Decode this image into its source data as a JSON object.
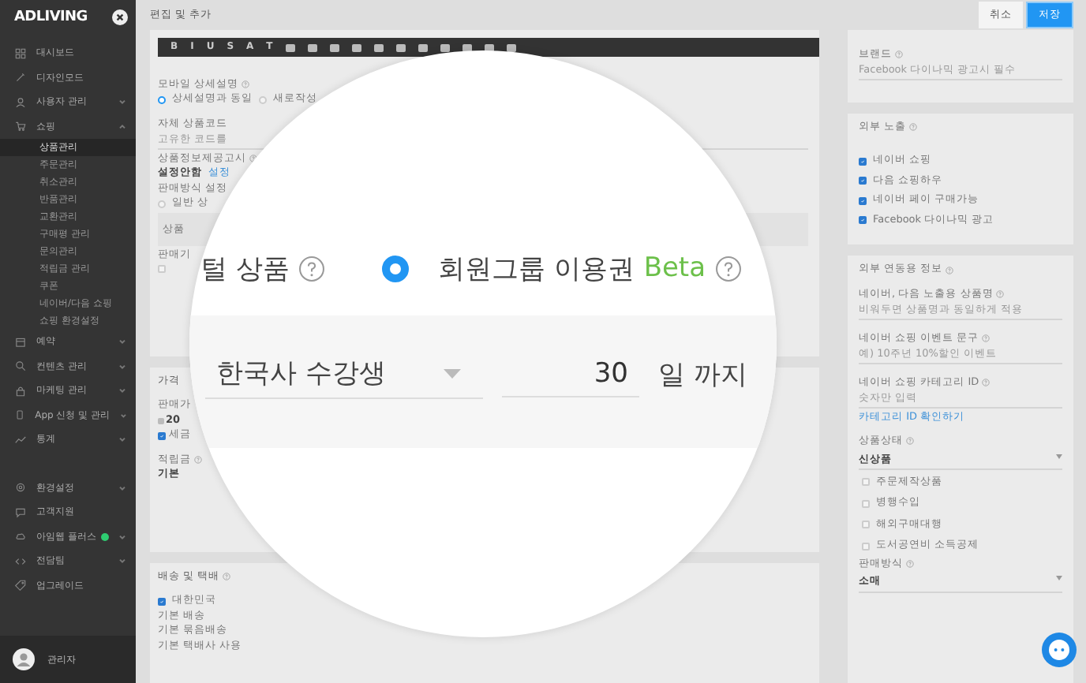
{
  "sidebar": {
    "brand": "ADLIVING",
    "items": [
      {
        "label": "대시보드",
        "kind": "link"
      },
      {
        "label": "디자인모드",
        "kind": "link"
      },
      {
        "label": "사용자 관리",
        "kind": "menu",
        "expanded": false
      },
      {
        "label": "쇼핑",
        "kind": "menu",
        "expanded": true,
        "children": [
          {
            "label": "상품관리",
            "selected": true
          },
          {
            "label": "주문관리",
            "selected": false
          },
          {
            "label": "취소관리",
            "selected": false
          },
          {
            "label": "반품관리",
            "selected": false
          },
          {
            "label": "교환관리",
            "selected": false
          },
          {
            "label": "구매평 관리",
            "selected": false
          },
          {
            "label": "문의관리",
            "selected": false
          },
          {
            "label": "적립금 관리",
            "selected": false
          },
          {
            "label": "쿠폰",
            "selected": false
          },
          {
            "label": "네이버/다음 쇼핑",
            "selected": false
          },
          {
            "label": "쇼핑 환경설정",
            "selected": false
          }
        ]
      },
      {
        "label": "예약",
        "kind": "menu",
        "expanded": false
      },
      {
        "label": "컨텐츠 관리",
        "kind": "menu",
        "expanded": false
      },
      {
        "label": "마케팅 관리",
        "kind": "menu",
        "expanded": false
      },
      {
        "label": "App 신청 및 관리",
        "kind": "menu",
        "expanded": false
      },
      {
        "label": "통계",
        "kind": "menu",
        "expanded": false
      }
    ],
    "bottom_items": [
      {
        "label": "환경설정",
        "kind": "menu",
        "expanded": false,
        "badge": false
      },
      {
        "label": "고객지원",
        "kind": "link",
        "badge": false
      },
      {
        "label": "아임웹 플러스",
        "kind": "menu",
        "expanded": false,
        "badge": true
      },
      {
        "label": "전담팀",
        "kind": "menu",
        "expanded": false,
        "badge": false
      },
      {
        "label": "업그레이드",
        "kind": "link",
        "badge": false
      }
    ],
    "user": {
      "name": "관리자"
    }
  },
  "header": {
    "title": "편집 및 추가",
    "buttons": [
      {
        "label": "취소",
        "primary": false
      },
      {
        "label": "저장",
        "primary": true
      }
    ]
  },
  "editor": {
    "toolbar": [
      "B",
      "I",
      "U",
      "S",
      "A",
      "T"
    ]
  },
  "details": {
    "mobile_label": "모바일 상세설명",
    "mobile_options": [
      {
        "label": "상세설명과 동일",
        "selected": true
      },
      {
        "label": "새로작성",
        "selected": false
      }
    ],
    "code_label": "자체 상품코드",
    "code_placeholder": "고유한 코드를",
    "notice_label": "상품정보제공고시",
    "notice_value": "설정안함",
    "notice_link": "설정",
    "sale_label": "판매방식 설정",
    "sale_option": {
      "label": "일반 상",
      "selected": false
    },
    "type_box": "상품",
    "period": {
      "label": "판매기",
      "checked": false
    }
  },
  "price": {
    "title": "가격",
    "price_label": "판매가",
    "price_value": "20",
    "tax": {
      "label": "세금",
      "checked": true
    },
    "points_label": "적립금",
    "points_value": "기본"
  },
  "shipping": {
    "title": "배송 및 택배",
    "domestic": {
      "label": "대한민국",
      "checked": true
    },
    "notes": [
      "기본 배송",
      "기본 묶음배송",
      "기본 택배사 사용"
    ]
  },
  "magnifier": {
    "option_cut": "털 상품",
    "option": {
      "label": "회원그룹 이용권",
      "badge": "Beta",
      "selected": true
    },
    "group": "한국사 수강생",
    "days": "30",
    "days_suffix": "일 까지"
  },
  "brand": {
    "label": "브랜드",
    "placeholder": "Facebook 다이나믹 광고시 필수"
  },
  "exposure": {
    "title": "외부 노출",
    "options": [
      {
        "label": "네이버 쇼핑",
        "checked": true
      },
      {
        "label": "다음 쇼핑하우",
        "checked": true
      },
      {
        "label": "네이버 페이 구매가능",
        "checked": true
      },
      {
        "label": "Facebook 다이나믹 광고",
        "checked": true
      }
    ]
  },
  "integration": {
    "title": "외부 연동용 정보",
    "fields": [
      {
        "label": "네이버, 다음 노출용 상품명",
        "placeholder": "비워두면 상품명과 동일하게 적용"
      },
      {
        "label": "네이버 쇼핑 이벤트 문구",
        "placeholder": "예) 10주년 10%할인 이벤트"
      },
      {
        "label": "네이버 쇼핑 카테고리 ID",
        "placeholder": "숫자만 입력",
        "link": "카테고리 ID 확인하기"
      }
    ],
    "condition_label": "상품상태",
    "condition_value": "신상품",
    "flags": [
      {
        "label": "주문제작상품",
        "checked": false
      },
      {
        "label": "병행수입",
        "checked": false
      },
      {
        "label": "해외구매대행",
        "checked": false
      },
      {
        "label": "도서공연비 소득공제",
        "checked": false
      }
    ],
    "sale_type_label": "판매방식",
    "sale_type_value": "소매"
  }
}
